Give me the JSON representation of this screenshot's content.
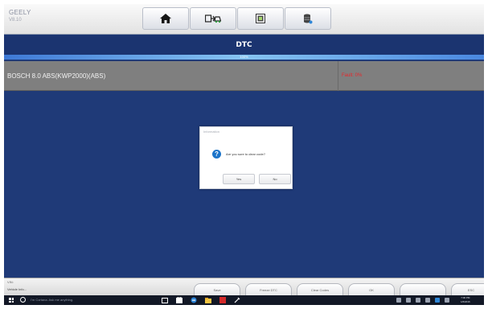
{
  "header": {
    "brand": "GEELY",
    "version": "V8.10",
    "toolbar": [
      {
        "name": "home-icon"
      },
      {
        "name": "vehicle-swap-icon"
      },
      {
        "name": "screenshot-icon"
      },
      {
        "name": "data-log-icon"
      }
    ]
  },
  "title": "DTC",
  "progress": {
    "value": 1.0,
    "label": "100%"
  },
  "dtc": {
    "system": "BOSCH 8.0 ABS(KWP2000)(ABS)",
    "status": "Fault: 0%"
  },
  "dialog": {
    "title": "Information",
    "message": "Are you sure to clear code?",
    "yes_label": "Yes",
    "no_label": "No"
  },
  "footer": {
    "vin_label": "VIN:",
    "vehicle_info": "Vehicle Info...",
    "buttons": [
      "Save",
      "Freeze DTC",
      "Clear Codes",
      "OK",
      "",
      "ESC"
    ]
  },
  "taskbar": {
    "search_placeholder": "I'm Cortana. Ask me anything.",
    "time": "7:00 PM",
    "date": "1/6/2016"
  },
  "colors": {
    "screen_bg": "#1f3a78",
    "titlebar": "#1b3470",
    "dtc_row": "#7f7f7f",
    "fault_text": "#e8262b",
    "dialog_icon": "#1c74c9"
  }
}
